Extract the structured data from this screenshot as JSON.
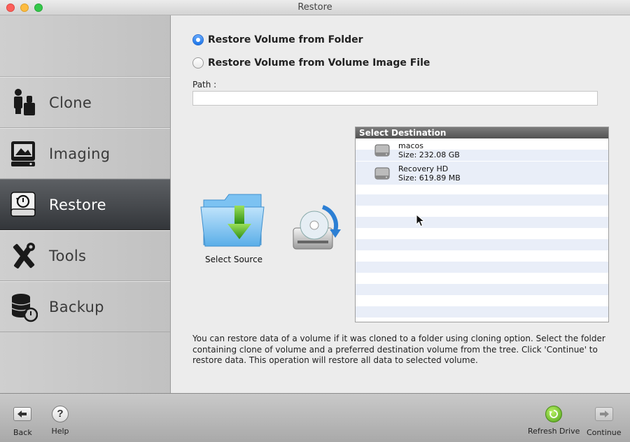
{
  "window": {
    "title": "Restore"
  },
  "sidebar": {
    "items": [
      {
        "label": "Clone",
        "icon": "clone-icon",
        "active": false
      },
      {
        "label": "Imaging",
        "icon": "imaging-icon",
        "active": false
      },
      {
        "label": "Restore",
        "icon": "restore-icon",
        "active": true
      },
      {
        "label": "Tools",
        "icon": "tools-icon",
        "active": false
      },
      {
        "label": "Backup",
        "icon": "backup-icon",
        "active": false
      }
    ]
  },
  "main": {
    "options": [
      {
        "label": "Restore Volume from Folder",
        "selected": true
      },
      {
        "label": "Restore Volume from Volume Image File",
        "selected": false
      }
    ],
    "path": {
      "label": "Path :",
      "value": ""
    },
    "source": {
      "label": "Select Source"
    },
    "destination": {
      "header": "Select Destination",
      "volumes": [
        {
          "name": "macos",
          "size": "Size: 232.08 GB"
        },
        {
          "name": "Recovery HD",
          "size": "Size: 619.89 MB"
        }
      ]
    },
    "description": "You can restore data of a volume if it was cloned to a folder using cloning option. Select the folder containing clone of volume and a preferred destination volume from the tree. Click 'Continue' to restore data. This operation will restore all data to selected volume."
  },
  "toolbar": {
    "back_label": "Back",
    "help_label": "Help",
    "refresh_label": "Refresh Drive",
    "continue_label": "Continue"
  },
  "colors": {
    "accent": "#1a74e8",
    "active_nav": "#3f4246",
    "refresh": "#5aae1f",
    "dest_header": "#5f5f5f"
  }
}
